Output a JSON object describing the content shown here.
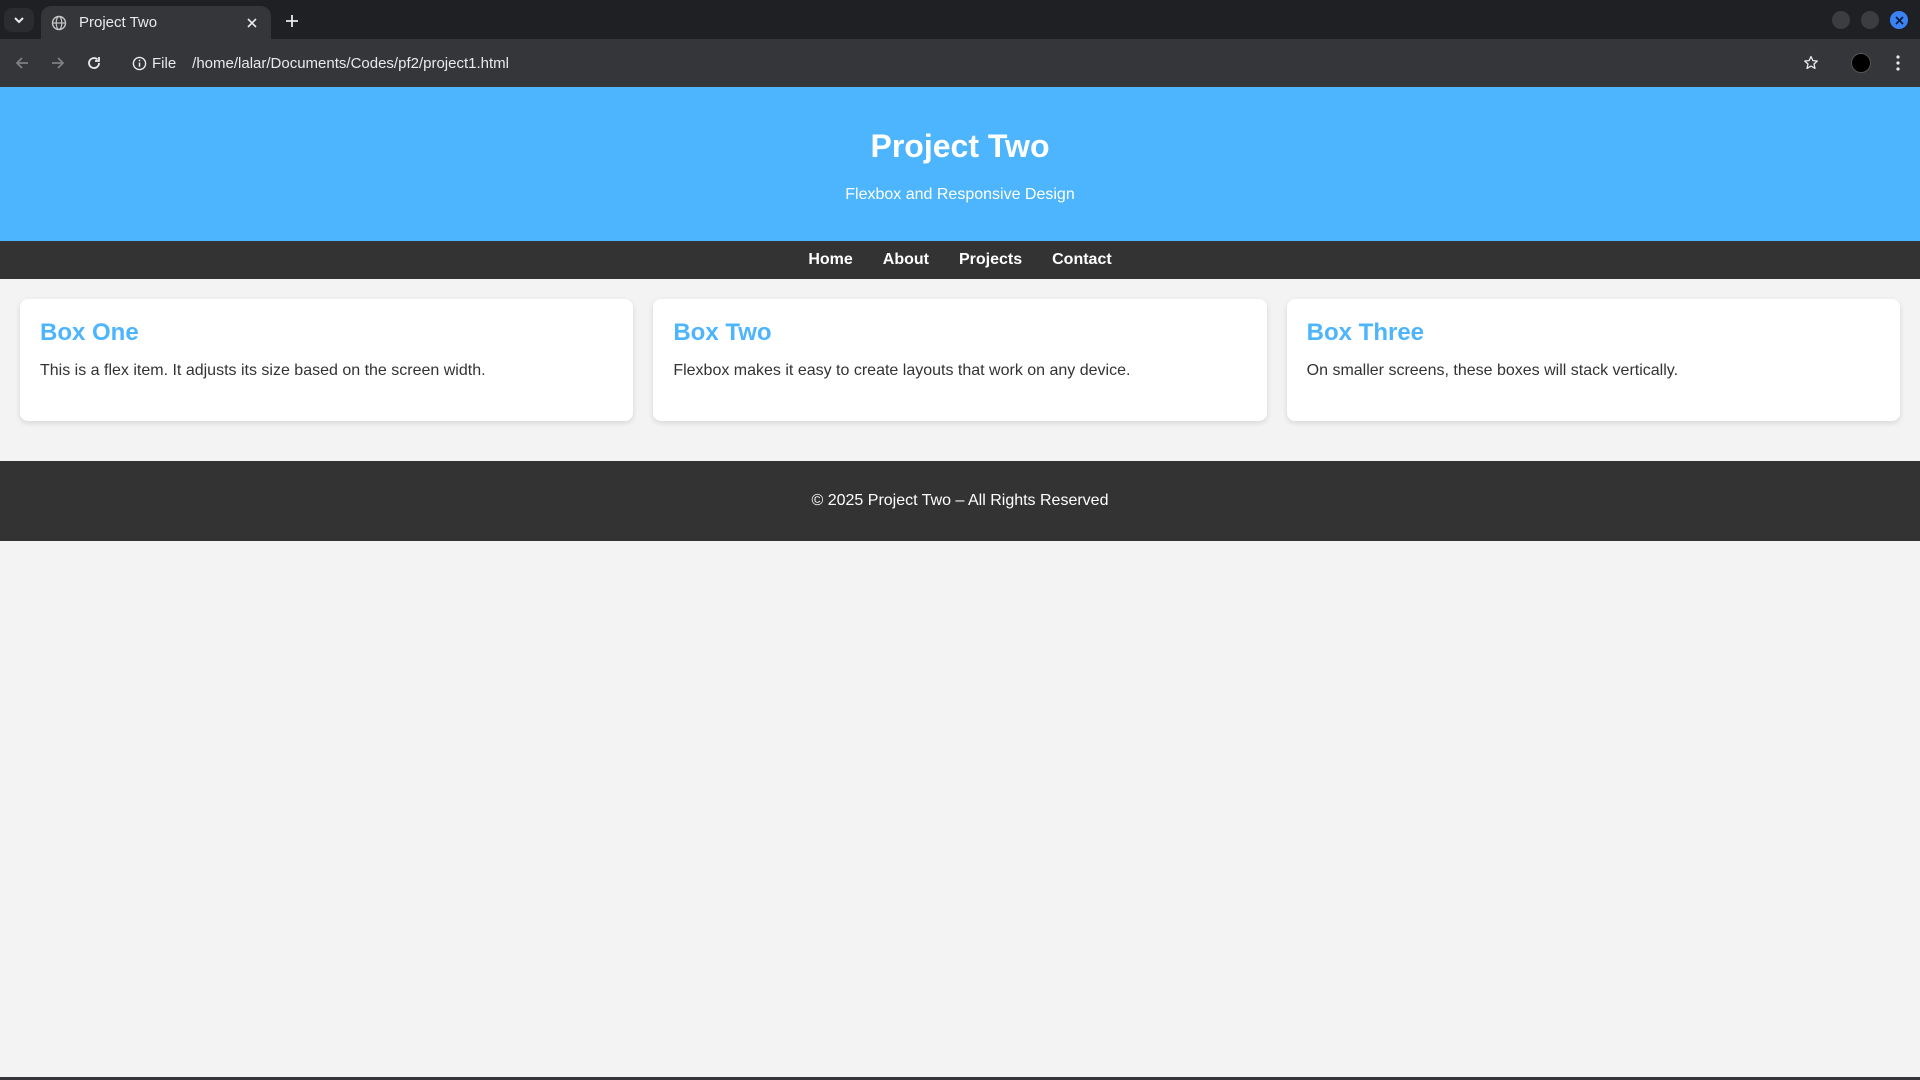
{
  "browser": {
    "tab": {
      "title": "Project Two",
      "favicon": "globe-icon"
    },
    "site_info_label": "File",
    "url": "/home/lalar/Documents/Codes/pf2/project1.html",
    "accent_color": "#3b82f6"
  },
  "page": {
    "header": {
      "title": "Project Two",
      "subtitle": "Flexbox and Responsive Design",
      "background": "#4db5fe"
    },
    "nav": {
      "items": [
        {
          "label": "Home"
        },
        {
          "label": "About"
        },
        {
          "label": "Projects"
        },
        {
          "label": "Contact"
        }
      ]
    },
    "boxes": [
      {
        "title": "Box One",
        "text": "This is a flex item. It adjusts its size based on the screen width."
      },
      {
        "title": "Box Two",
        "text": "Flexbox makes it easy to create layouts that work on any device."
      },
      {
        "title": "Box Three",
        "text": "On smaller screens, these boxes will stack vertically."
      }
    ],
    "footer": {
      "text": "© 2025 Project Two – All Rights Reserved"
    }
  }
}
